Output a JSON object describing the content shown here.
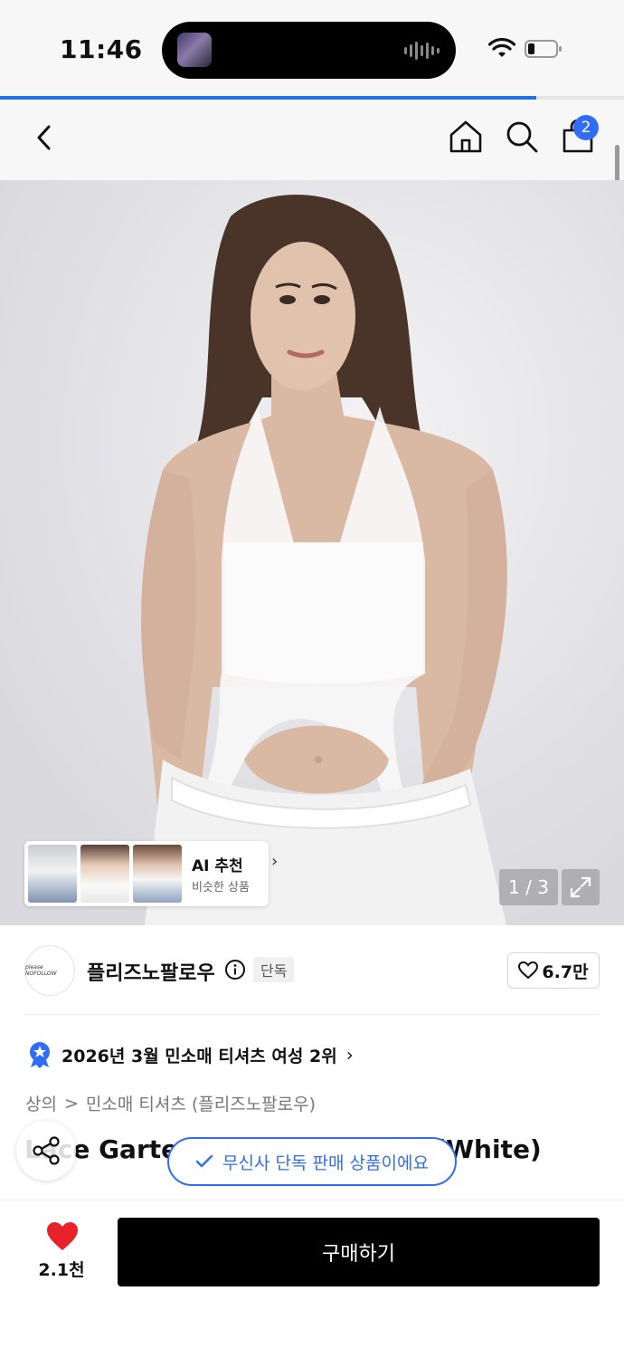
{
  "status_bar": {
    "time": "11:46"
  },
  "progress": {
    "fraction": 0.86
  },
  "nav": {
    "cart_count": "2"
  },
  "gallery": {
    "page_counter": "1 / 3",
    "ai_card": {
      "title": "AI 추천",
      "subtitle": "비슷한 상품"
    }
  },
  "brand": {
    "name": "플리즈노팔로우",
    "logo_text": "please NOFOLLOW",
    "tag": "단독",
    "likes": "6.7만"
  },
  "ranking": {
    "text": "2026년 3월 민소매 티셔츠 여성 2위"
  },
  "breadcrumb": {
    "category": "상의",
    "separator": ">",
    "sub": "민소매 티셔츠 (플리즈노팔로우)"
  },
  "product": {
    "title": "Lace Garter Halter Neck Top (White)"
  },
  "toast": {
    "text": "무신사 단독 판매 상품이에요"
  },
  "bottom": {
    "fav_count": "2.1천",
    "buy_label": "구매하기"
  },
  "colors": {
    "accent": "#2f6df5",
    "heart": "#e8222b",
    "buy_bg": "#000000"
  }
}
